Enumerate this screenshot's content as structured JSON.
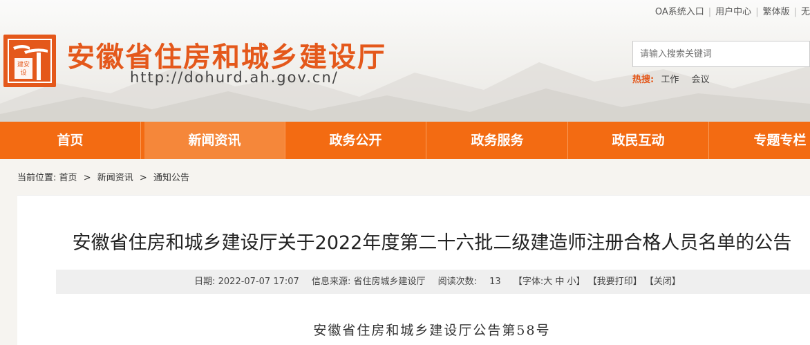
{
  "header": {
    "top_links": [
      "OA系统入口",
      "用户中心",
      "繁体版",
      "无"
    ],
    "site_title": "安徽省住房和城乡建设厅",
    "site_url": "http://dohurd.ah.gov.cn/",
    "logo_text": "建安设",
    "search_placeholder": "请输入搜索关键词",
    "hot_label": "热搜:",
    "hot_items": [
      "工作",
      "会议"
    ],
    "brand_color": "#e4581b"
  },
  "nav": {
    "items": [
      "首页",
      "新闻资讯",
      "政务公开",
      "政务服务",
      "政民互动",
      "专题专栏"
    ],
    "active_index": 1,
    "bg_color": "#f36b12"
  },
  "breadcrumb": {
    "label": "当前位置:",
    "items": [
      "首页",
      "新闻资讯",
      "通知公告"
    ],
    "separator": ">"
  },
  "article": {
    "title": "安徽省住房和城乡建设厅关于2022年度第二十六批二级建造师注册合格人员名单的公告",
    "date_label": "日期:",
    "date": "2022-07-07 17:07",
    "source_label": "信息来源:",
    "source": "省住房城乡建设厅",
    "views_label": "阅读次数:",
    "views": "13",
    "font_label": "【字体:",
    "font_sizes": [
      "大",
      "中",
      "小"
    ],
    "font_close": "】",
    "print": "【我要打印】",
    "close": "【关闭】",
    "notice_number": "安徽省住房和城乡建设厅公告第58号"
  }
}
